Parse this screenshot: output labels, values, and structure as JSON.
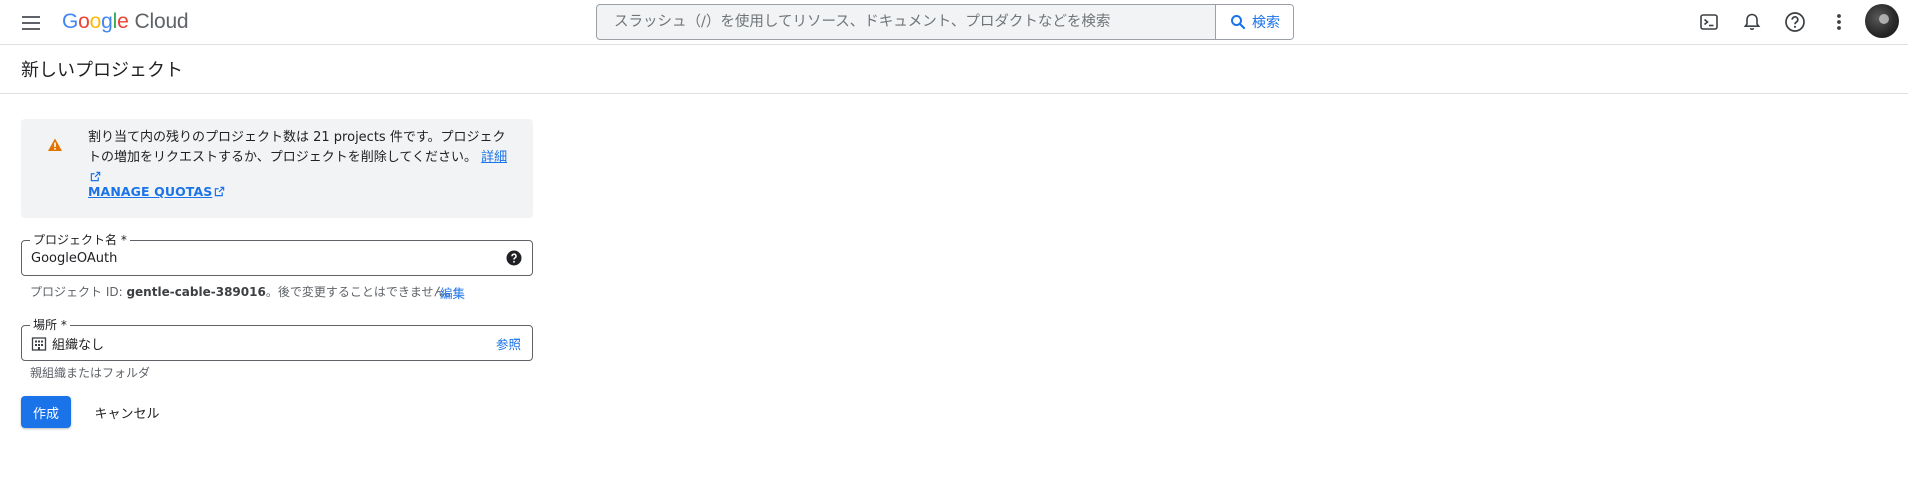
{
  "header": {
    "logo_letters": [
      "G",
      "o",
      "o",
      "g",
      "l",
      "e"
    ],
    "logo_product": "Cloud",
    "search_placeholder": "スラッシュ（/）を使用してリソース、ドキュメント、プロダクトなどを検索",
    "search_button_label": "検索",
    "icons": [
      "menu-icon",
      "cloud-shell-icon",
      "notifications-icon",
      "help-icon",
      "more-vert-icon",
      "avatar"
    ]
  },
  "page": {
    "title": "新しいプロジェクト"
  },
  "quota_warning": {
    "icon": "warning-icon",
    "text": "割り当て内の残りのプロジェクト数は 21 projects 件です。プロジェクトの増加をリクエストするか、プロジェクトを削除してください。",
    "details_link": "詳細",
    "manage_quotas_link": "MANAGE QUOTAS"
  },
  "project_name": {
    "label": "プロジェクト名 *",
    "value": "GoogleOAuth",
    "hint_prefix": "プロジェクト ID: ",
    "project_id": "gentle-cable-389016",
    "hint_suffix": "。後で変更することはできません。",
    "edit_link": "編集"
  },
  "location": {
    "label": "場所 *",
    "value": "組織なし",
    "browse_link": "参照",
    "hint": "親組織またはフォルダ"
  },
  "actions": {
    "create_label": "作成",
    "cancel_label": "キャンセル"
  },
  "colors": {
    "accent": "#1a73e8",
    "warning": "#e37400",
    "box_background": "#f1f3f4"
  }
}
